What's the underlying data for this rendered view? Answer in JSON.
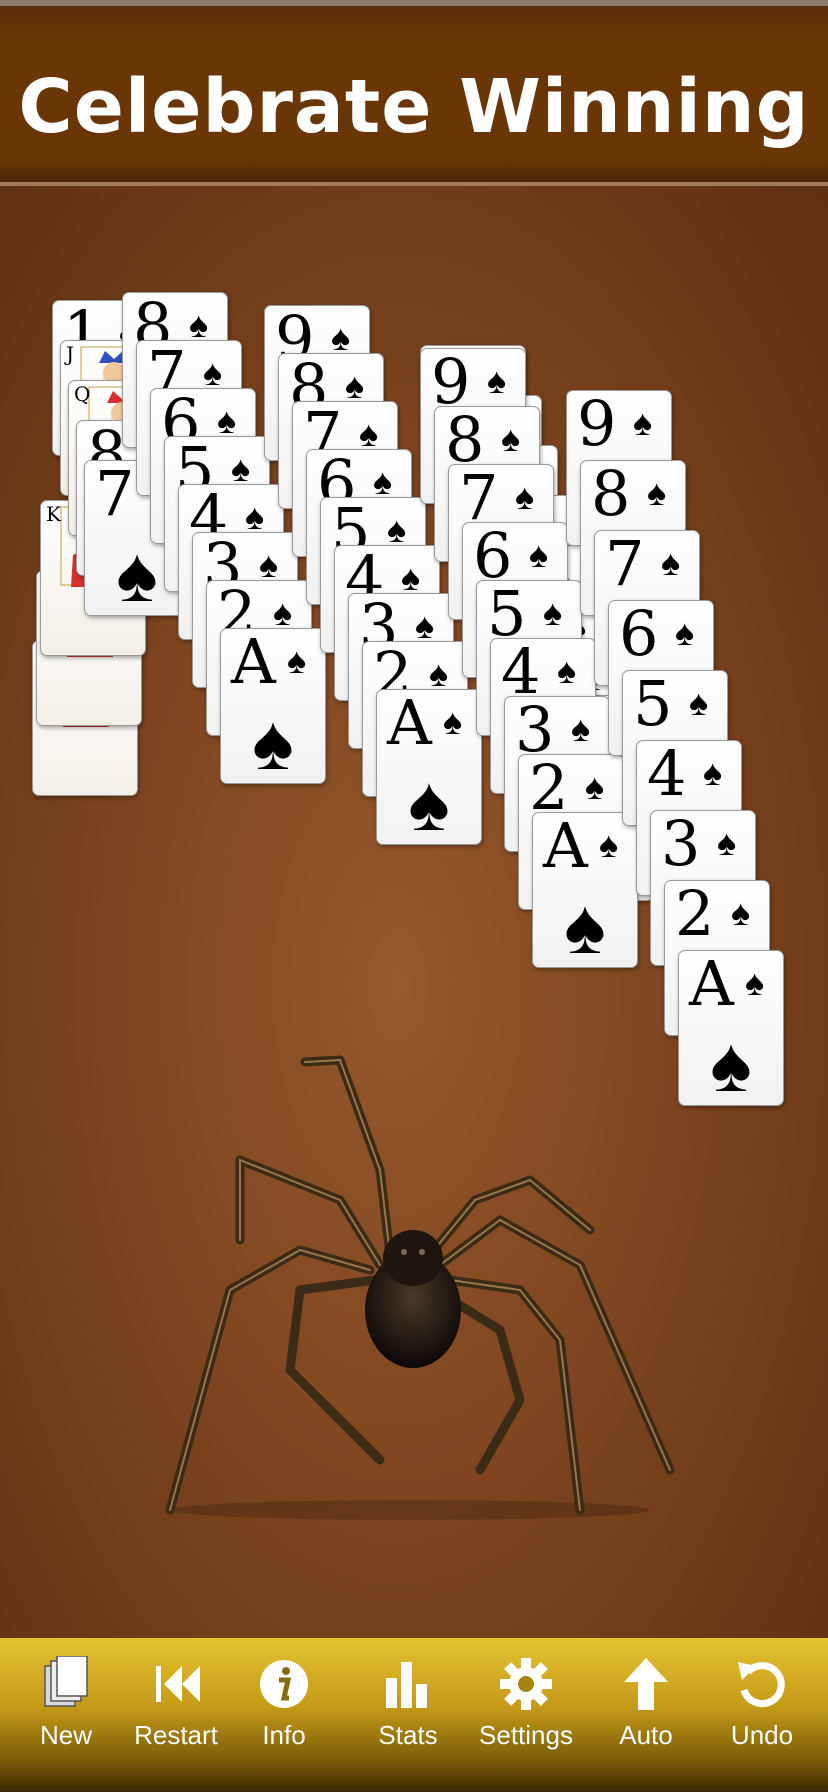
{
  "banner": {
    "title": "Celebrate Winning"
  },
  "toolbar": {
    "items": [
      {
        "label": "New",
        "icon": "new-deck-icon"
      },
      {
        "label": "Restart",
        "icon": "rewind-icon"
      },
      {
        "label": "Info",
        "icon": "info-icon"
      },
      {
        "label": "Stats",
        "icon": "bar-chart-icon"
      },
      {
        "label": "Settings",
        "icon": "gear-icon"
      },
      {
        "label": "Auto",
        "icon": "arrow-up-icon"
      },
      {
        "label": "Undo",
        "icon": "undo-icon"
      }
    ]
  },
  "game": {
    "suit": "♠",
    "columns": [
      [
        "J",
        "Q",
        "K"
      ],
      [
        "1",
        "J",
        "Q",
        "8",
        "7"
      ],
      [
        "8",
        "7",
        "6",
        "5",
        "4",
        "3",
        "2",
        "A"
      ],
      [
        "9",
        "8",
        "7",
        "6",
        "5",
        "4",
        "3",
        "2",
        "A"
      ],
      [
        "9",
        "8",
        "7",
        "6",
        "5",
        "4",
        "3",
        "2",
        "A"
      ],
      [
        "9",
        "8",
        "7",
        "6",
        "5",
        "4",
        "3",
        "2",
        "A"
      ],
      [
        "9",
        "8",
        "7",
        "6",
        "5",
        "4",
        "3",
        "2",
        "A"
      ]
    ]
  }
}
